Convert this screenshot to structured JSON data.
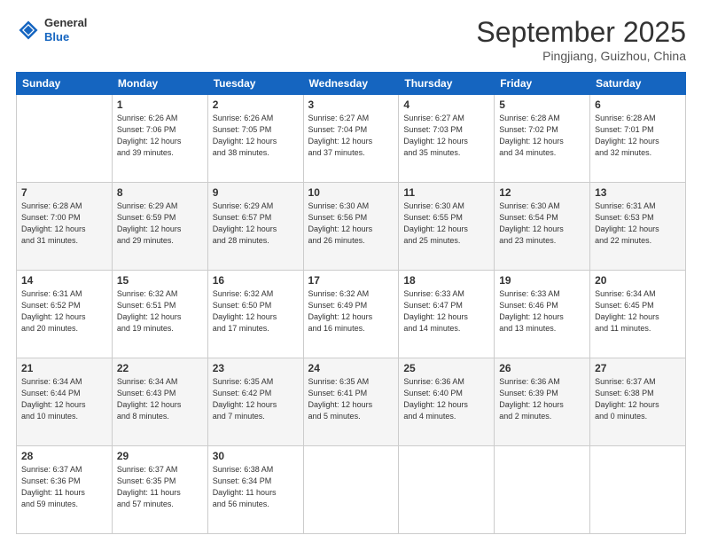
{
  "header": {
    "logo": {
      "line1": "General",
      "line2": "Blue"
    },
    "title": "September 2025",
    "subtitle": "Pingjiang, Guizhou, China"
  },
  "weekdays": [
    "Sunday",
    "Monday",
    "Tuesday",
    "Wednesday",
    "Thursday",
    "Friday",
    "Saturday"
  ],
  "weeks": [
    [
      {
        "day": "",
        "info": ""
      },
      {
        "day": "1",
        "info": "Sunrise: 6:26 AM\nSunset: 7:06 PM\nDaylight: 12 hours\nand 39 minutes."
      },
      {
        "day": "2",
        "info": "Sunrise: 6:26 AM\nSunset: 7:05 PM\nDaylight: 12 hours\nand 38 minutes."
      },
      {
        "day": "3",
        "info": "Sunrise: 6:27 AM\nSunset: 7:04 PM\nDaylight: 12 hours\nand 37 minutes."
      },
      {
        "day": "4",
        "info": "Sunrise: 6:27 AM\nSunset: 7:03 PM\nDaylight: 12 hours\nand 35 minutes."
      },
      {
        "day": "5",
        "info": "Sunrise: 6:28 AM\nSunset: 7:02 PM\nDaylight: 12 hours\nand 34 minutes."
      },
      {
        "day": "6",
        "info": "Sunrise: 6:28 AM\nSunset: 7:01 PM\nDaylight: 12 hours\nand 32 minutes."
      }
    ],
    [
      {
        "day": "7",
        "info": "Sunrise: 6:28 AM\nSunset: 7:00 PM\nDaylight: 12 hours\nand 31 minutes."
      },
      {
        "day": "8",
        "info": "Sunrise: 6:29 AM\nSunset: 6:59 PM\nDaylight: 12 hours\nand 29 minutes."
      },
      {
        "day": "9",
        "info": "Sunrise: 6:29 AM\nSunset: 6:57 PM\nDaylight: 12 hours\nand 28 minutes."
      },
      {
        "day": "10",
        "info": "Sunrise: 6:30 AM\nSunset: 6:56 PM\nDaylight: 12 hours\nand 26 minutes."
      },
      {
        "day": "11",
        "info": "Sunrise: 6:30 AM\nSunset: 6:55 PM\nDaylight: 12 hours\nand 25 minutes."
      },
      {
        "day": "12",
        "info": "Sunrise: 6:30 AM\nSunset: 6:54 PM\nDaylight: 12 hours\nand 23 minutes."
      },
      {
        "day": "13",
        "info": "Sunrise: 6:31 AM\nSunset: 6:53 PM\nDaylight: 12 hours\nand 22 minutes."
      }
    ],
    [
      {
        "day": "14",
        "info": "Sunrise: 6:31 AM\nSunset: 6:52 PM\nDaylight: 12 hours\nand 20 minutes."
      },
      {
        "day": "15",
        "info": "Sunrise: 6:32 AM\nSunset: 6:51 PM\nDaylight: 12 hours\nand 19 minutes."
      },
      {
        "day": "16",
        "info": "Sunrise: 6:32 AM\nSunset: 6:50 PM\nDaylight: 12 hours\nand 17 minutes."
      },
      {
        "day": "17",
        "info": "Sunrise: 6:32 AM\nSunset: 6:49 PM\nDaylight: 12 hours\nand 16 minutes."
      },
      {
        "day": "18",
        "info": "Sunrise: 6:33 AM\nSunset: 6:47 PM\nDaylight: 12 hours\nand 14 minutes."
      },
      {
        "day": "19",
        "info": "Sunrise: 6:33 AM\nSunset: 6:46 PM\nDaylight: 12 hours\nand 13 minutes."
      },
      {
        "day": "20",
        "info": "Sunrise: 6:34 AM\nSunset: 6:45 PM\nDaylight: 12 hours\nand 11 minutes."
      }
    ],
    [
      {
        "day": "21",
        "info": "Sunrise: 6:34 AM\nSunset: 6:44 PM\nDaylight: 12 hours\nand 10 minutes."
      },
      {
        "day": "22",
        "info": "Sunrise: 6:34 AM\nSunset: 6:43 PM\nDaylight: 12 hours\nand 8 minutes."
      },
      {
        "day": "23",
        "info": "Sunrise: 6:35 AM\nSunset: 6:42 PM\nDaylight: 12 hours\nand 7 minutes."
      },
      {
        "day": "24",
        "info": "Sunrise: 6:35 AM\nSunset: 6:41 PM\nDaylight: 12 hours\nand 5 minutes."
      },
      {
        "day": "25",
        "info": "Sunrise: 6:36 AM\nSunset: 6:40 PM\nDaylight: 12 hours\nand 4 minutes."
      },
      {
        "day": "26",
        "info": "Sunrise: 6:36 AM\nSunset: 6:39 PM\nDaylight: 12 hours\nand 2 minutes."
      },
      {
        "day": "27",
        "info": "Sunrise: 6:37 AM\nSunset: 6:38 PM\nDaylight: 12 hours\nand 0 minutes."
      }
    ],
    [
      {
        "day": "28",
        "info": "Sunrise: 6:37 AM\nSunset: 6:36 PM\nDaylight: 11 hours\nand 59 minutes."
      },
      {
        "day": "29",
        "info": "Sunrise: 6:37 AM\nSunset: 6:35 PM\nDaylight: 11 hours\nand 57 minutes."
      },
      {
        "day": "30",
        "info": "Sunrise: 6:38 AM\nSunset: 6:34 PM\nDaylight: 11 hours\nand 56 minutes."
      },
      {
        "day": "",
        "info": ""
      },
      {
        "day": "",
        "info": ""
      },
      {
        "day": "",
        "info": ""
      },
      {
        "day": "",
        "info": ""
      }
    ]
  ]
}
